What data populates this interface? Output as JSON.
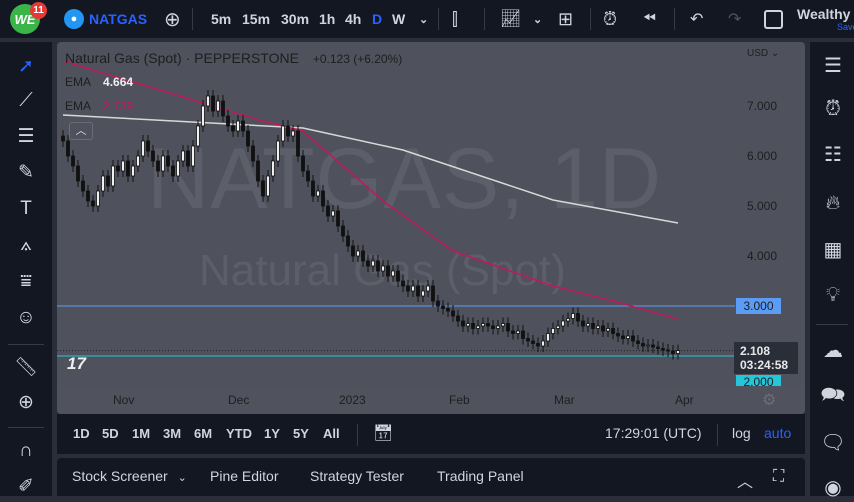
{
  "topbar": {
    "badge": "11",
    "symbol": "NATGAS",
    "intervals": [
      "5m",
      "15m",
      "30m",
      "1h",
      "4h",
      "D",
      "W"
    ],
    "active_interval": "D",
    "user": "Wealthy",
    "save": "Save"
  },
  "legend": {
    "title": "Natural Gas (Spot) · PEPPERSTONE",
    "change": "+0.123 (+6.20%)",
    "ema1_label": "EMA",
    "ema1_value": "4.664",
    "ema2_label": "EMA",
    "ema2_value": "2.739"
  },
  "watermark": {
    "line1": "NATGAS, 1D",
    "line2": "Natural Gas (Spot)"
  },
  "axis": {
    "currency": "USD",
    "price_ticks": [
      "7.000",
      "6.000",
      "5.000",
      "4.000"
    ],
    "price_tick_values": [
      7,
      6,
      5,
      4
    ],
    "time_ticks": [
      "Nov",
      "Dec",
      "2023",
      "Feb",
      "Mar",
      "Apr"
    ]
  },
  "labels": {
    "hline": "3.000",
    "last_price": "2.108",
    "countdown": "03:24:58",
    "support": "2.000"
  },
  "colors": {
    "ema_slow": "#d8d8d8",
    "ema_fast": "#c2185b",
    "hline": "#5b9cf6",
    "support": "#26c6da",
    "accent": "#2962ff"
  },
  "rangebar": {
    "ranges": [
      "1D",
      "5D",
      "1M",
      "3M",
      "6M",
      "YTD",
      "1Y",
      "5Y",
      "All"
    ],
    "time": "17:29:01 (UTC)",
    "log": "log",
    "auto": "auto"
  },
  "bottombar": {
    "tabs": [
      "Stock Screener",
      "Pine Editor",
      "Strategy Tester",
      "Trading Panel"
    ]
  },
  "chart_data": {
    "type": "candlestick",
    "closes": [
      6.3,
      6.0,
      5.8,
      5.5,
      5.3,
      5.1,
      5.0,
      5.3,
      5.6,
      5.4,
      5.8,
      5.7,
      5.9,
      5.6,
      5.8,
      6.0,
      6.3,
      6.1,
      5.9,
      5.7,
      6.0,
      5.8,
      5.6,
      5.9,
      6.1,
      5.8,
      6.2,
      6.6,
      7.0,
      7.2,
      6.9,
      7.1,
      6.8,
      6.6,
      6.5,
      6.7,
      6.5,
      6.2,
      5.9,
      5.5,
      5.2,
      5.6,
      5.9,
      6.3,
      6.6,
      6.4,
      6.5,
      6.0,
      5.7,
      5.5,
      5.2,
      5.3,
      5.0,
      4.8,
      4.9,
      4.6,
      4.4,
      4.2,
      4.0,
      4.1,
      3.9,
      3.8,
      3.9,
      3.7,
      3.8,
      3.6,
      3.7,
      3.5,
      3.4,
      3.3,
      3.4,
      3.2,
      3.3,
      3.4,
      3.1,
      3.0,
      2.95,
      2.9,
      2.8,
      2.7,
      2.6,
      2.65,
      2.55,
      2.6,
      2.65,
      2.6,
      2.55,
      2.6,
      2.65,
      2.5,
      2.45,
      2.5,
      2.35,
      2.3,
      2.25,
      2.2,
      2.3,
      2.45,
      2.55,
      2.6,
      2.7,
      2.75,
      2.85,
      2.7,
      2.6,
      2.65,
      2.55,
      2.6,
      2.5,
      2.55,
      2.45,
      2.4,
      2.35,
      2.4,
      2.3,
      2.25,
      2.2,
      2.22,
      2.18,
      2.15,
      2.12,
      2.1,
      2.05,
      2.108
    ],
    "ema_slow": [
      [
        0,
        6.82
      ],
      [
        48,
        6.56
      ],
      [
        68,
        6.12
      ],
      [
        98,
        5.12
      ],
      [
        123,
        4.66
      ]
    ],
    "ema_fast": [
      [
        0,
        7.9
      ],
      [
        20,
        7.3
      ],
      [
        40,
        6.7
      ],
      [
        48,
        6.5
      ],
      [
        64,
        5.1
      ],
      [
        78,
        4.1
      ],
      [
        98,
        3.4
      ],
      [
        110,
        3.1
      ],
      [
        123,
        2.74
      ]
    ],
    "hline": 3.0,
    "support": 2.0,
    "last": 2.108
  }
}
